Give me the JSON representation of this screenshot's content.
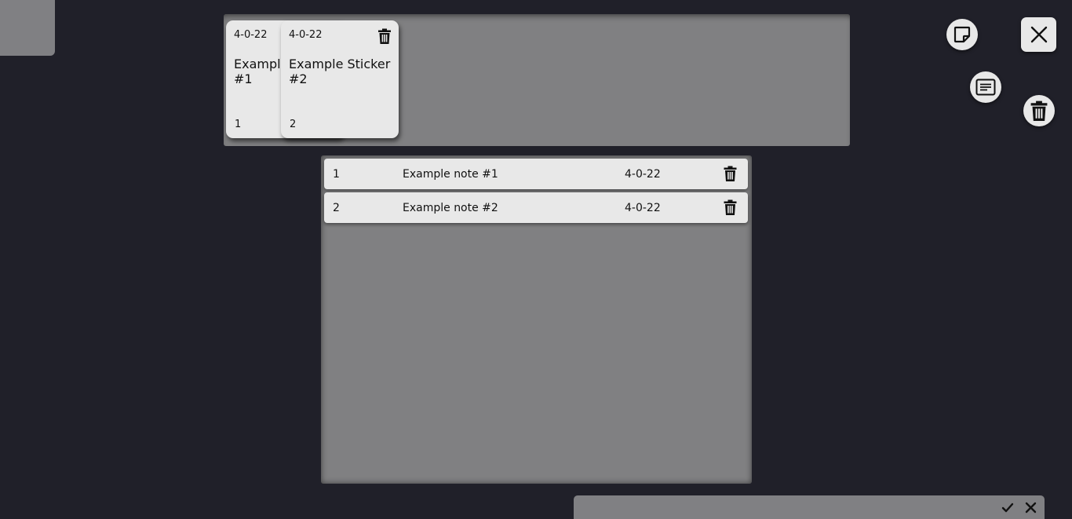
{
  "stickers": [
    {
      "date": "4-0-22",
      "title": "Example Sticker #1",
      "id": "1"
    },
    {
      "date": "4-0-22",
      "title": "Example Sticker #2",
      "id": "2"
    }
  ],
  "notes": [
    {
      "id": "1",
      "text": "Example note #1",
      "date": "4-0-22"
    },
    {
      "id": "2",
      "text": "Example note #2",
      "date": "4-0-22"
    }
  ],
  "toolbar": {
    "icons": [
      "new-sticker-icon",
      "new-note-icon",
      "delete-all-icon",
      "close-icon"
    ]
  },
  "bottom_bar": {
    "icons": [
      "check-icon",
      "close-icon"
    ]
  },
  "colors": {
    "background": "#202029",
    "panel": "#808082",
    "card": "#e8e8e8",
    "icon": "#111111"
  }
}
